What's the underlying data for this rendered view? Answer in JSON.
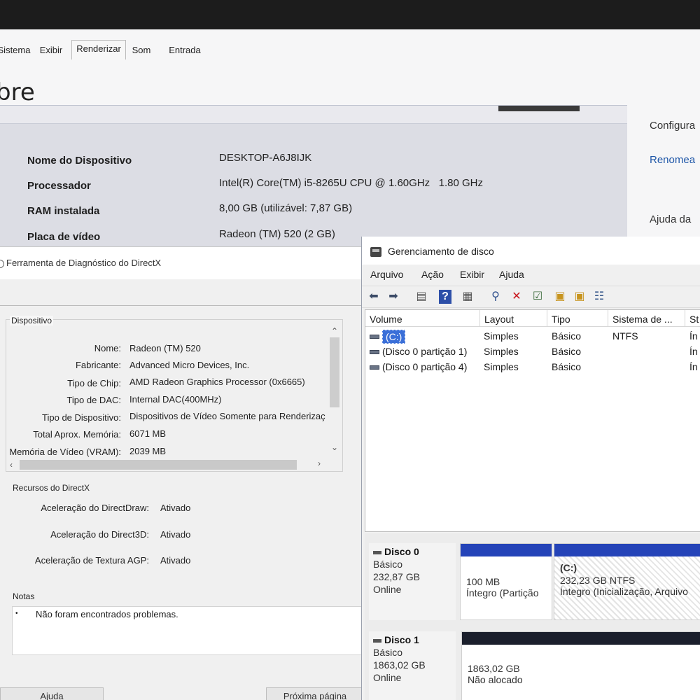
{
  "settings": {
    "page_title": "bre",
    "specs": [
      {
        "label": "Nome do Dispositivo",
        "value": "DESKTOP-A6J8IJK"
      },
      {
        "label": "Processador",
        "value": "Intel(R) Core(TM) i5-8265U CPU @ 1.60GHz   1.80 GHz"
      },
      {
        "label": "RAM instalada",
        "value": "8,00 GB (utilizável: 7,87 GB)"
      },
      {
        "label": "Placa de vídeo",
        "value": "Radeon (TM) 520 (2 GB)"
      }
    ],
    "right_links": [
      "Configura",
      "Renomea",
      "Ajuda da"
    ]
  },
  "dxdiag": {
    "title": "Ferramenta de Diagnóstico do DirectX",
    "tabs": [
      "Sistema",
      "Exibir",
      "Renderizar",
      "Som",
      "Entrada"
    ],
    "active_tab": "Renderizar",
    "device_group_title": "Dispositivo",
    "device_fields": [
      {
        "label": "Nome:",
        "value": "Radeon (TM) 520"
      },
      {
        "label": "Fabricante:",
        "value": "Advanced Micro Devices, Inc."
      },
      {
        "label": "Tipo de Chip:",
        "value": "AMD Radeon Graphics Processor (0x6665)"
      },
      {
        "label": "Tipo de DAC:",
        "value": "Internal DAC(400MHz)"
      },
      {
        "label": "Tipo de Dispositivo:",
        "value": "Dispositivos de Vídeo Somente para Renderizaç"
      },
      {
        "label": "Total Aprox. Memória:",
        "value": "6071 MB"
      },
      {
        "label": "Memória de Vídeo (VRAM):",
        "value": "2039 MB"
      }
    ],
    "resources_title": "Recursos do DirectX",
    "resources": [
      {
        "label": "Aceleração do DirectDraw:",
        "value": "Ativado"
      },
      {
        "label": "Aceleração do Direct3D:",
        "value": "Ativado"
      },
      {
        "label": "Aceleração de Textura AGP:",
        "value": "Ativado"
      }
    ],
    "notes_title": "Notas",
    "notes": [
      "Não foram encontrados problemas."
    ],
    "buttons": {
      "help": "Ajuda",
      "next": "Próxima página"
    }
  },
  "disk_management": {
    "title": "Gerenciamento de disco",
    "menu": [
      "Arquivo",
      "Ação",
      "Exibir",
      "Ajuda"
    ],
    "columns": [
      "Volume",
      "Layout",
      "Tipo",
      "Sistema de ...",
      "St"
    ],
    "volumes": [
      {
        "volume": "(C:)",
        "layout": "Simples",
        "type": "Básico",
        "fs": "NTFS",
        "status": "Ín",
        "selected": true
      },
      {
        "volume": "(Disco 0 partição 1)",
        "layout": "Simples",
        "type": "Básico",
        "fs": "",
        "status": "Ín",
        "selected": false
      },
      {
        "volume": "(Disco 0 partição 4)",
        "layout": "Simples",
        "type": "Básico",
        "fs": "",
        "status": "Ín",
        "selected": false
      }
    ],
    "disks": [
      {
        "name": "Disco 0",
        "kind": "Básico",
        "size": "232,87 GB",
        "status": "Online",
        "partitions": [
          {
            "title": "",
            "size": "100 MB",
            "status": "Íntegro (Partição",
            "bar_color": "#2443b8"
          },
          {
            "title": "(C:)",
            "size": "232,23 GB NTFS",
            "status": "Íntegro (Inicialização, Arquivo",
            "bar_color": "#2443b8"
          }
        ]
      },
      {
        "name": "Disco 1",
        "kind": "Básico",
        "size": "1863,02 GB",
        "status": "Online",
        "partitions": [
          {
            "title": "",
            "size": "1863,02 GB",
            "status": "Não alocado",
            "bar_color": "#1b1f2c"
          }
        ]
      }
    ],
    "colors": {
      "selection": "#3a6fd8",
      "primary_bar": "#2443b8",
      "unallocated_bar": "#1b1f2c"
    }
  }
}
